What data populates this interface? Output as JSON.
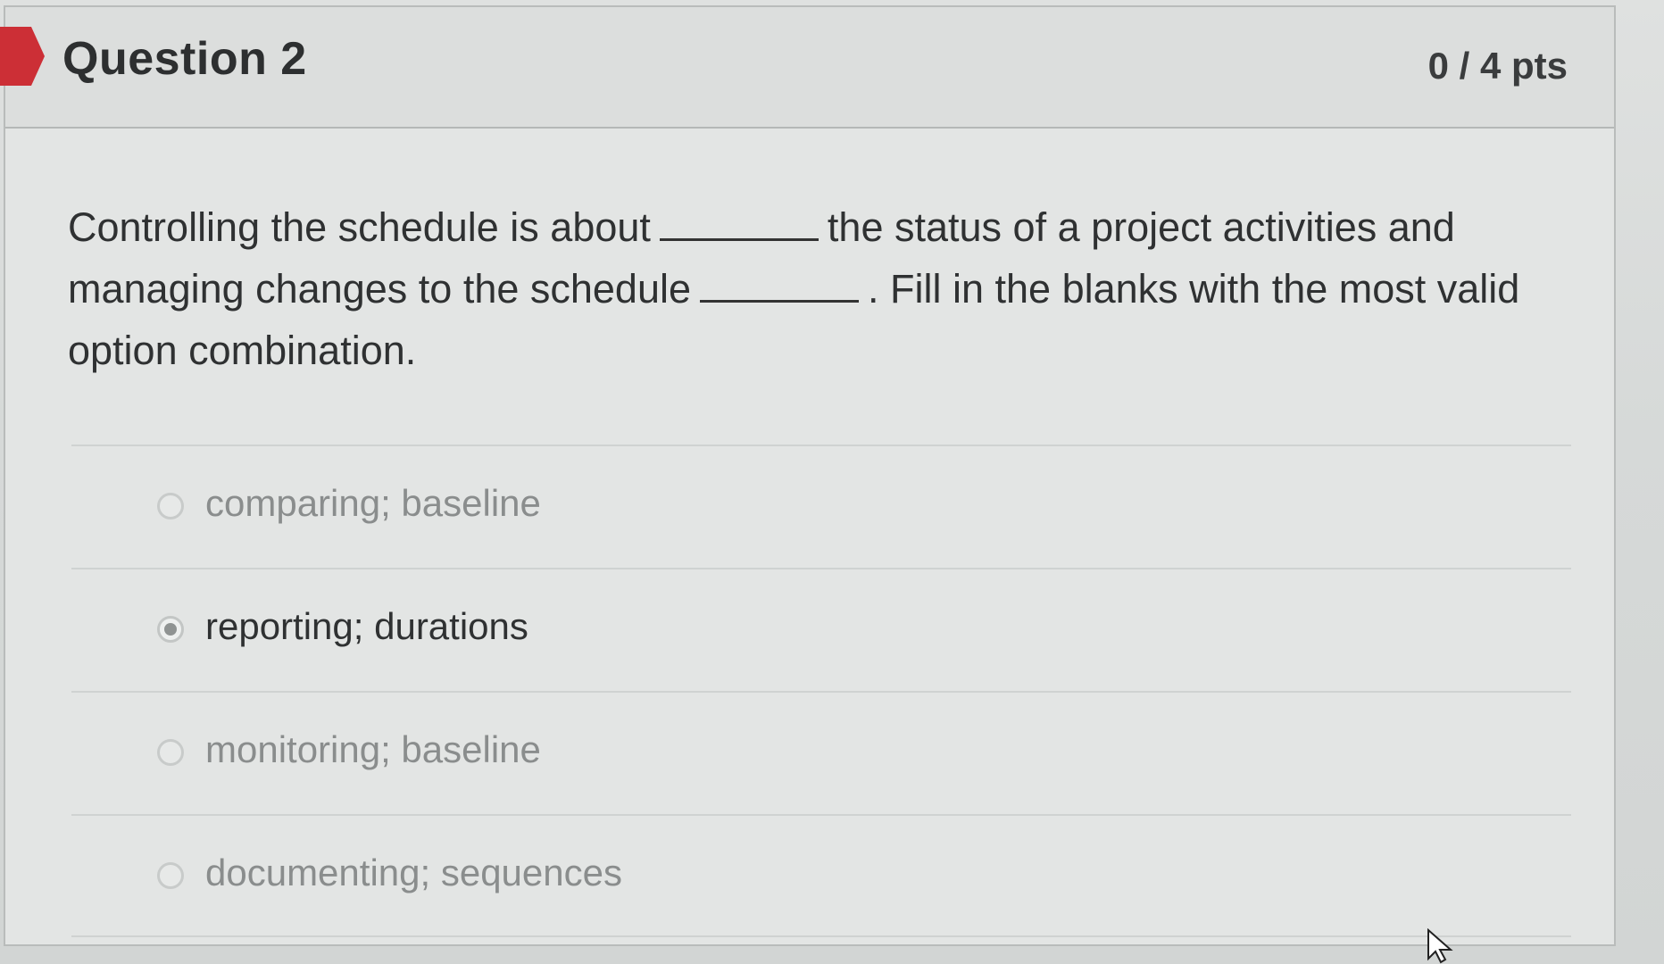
{
  "question": {
    "title": "Question 2",
    "points": "0 / 4 pts",
    "text_part1": "Controlling the schedule is about",
    "text_part2": "the status of a project activities and managing changes to the schedule",
    "text_part3": ". Fill in the blanks with the most valid option combination."
  },
  "answers": [
    {
      "label": "comparing; baseline",
      "selected": false
    },
    {
      "label": "reporting; durations",
      "selected": true
    },
    {
      "label": "monitoring; baseline",
      "selected": false
    },
    {
      "label": "documenting; sequences",
      "selected": false
    }
  ],
  "colors": {
    "flag": "#cc2f36",
    "text_primary": "#2f3132",
    "text_muted": "#8a8d8d"
  },
  "icons": {
    "flag": "flag-marker-icon",
    "cursor": "mouse-pointer-icon"
  }
}
